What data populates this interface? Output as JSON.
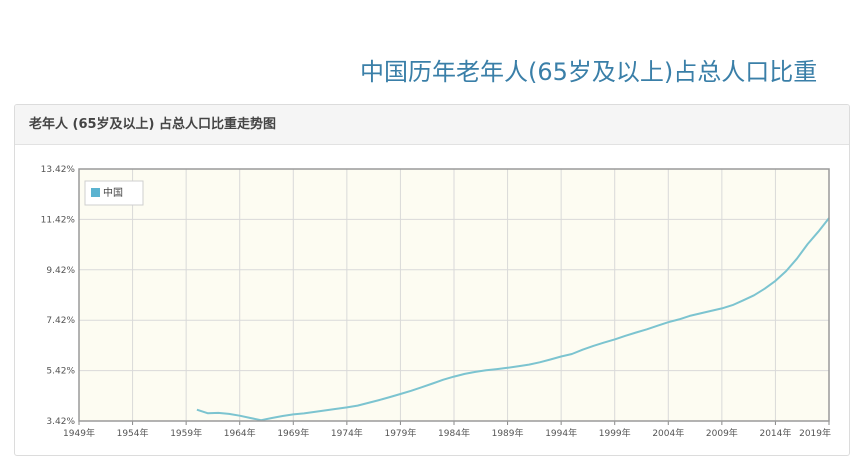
{
  "page": {
    "title": "中国历年老年人(65岁及以上)占总人口比重"
  },
  "panel": {
    "heading": "老年人 (65岁及以上) 占总人口比重走势图"
  },
  "colors": {
    "line": "#7cc4d0",
    "legend_swatch": "#5bb3d0",
    "plot_bg": "#fdfcf2",
    "grid": "#d9d9d9",
    "title": "#3a7fa8"
  },
  "chart_data": {
    "type": "line",
    "title": "老年人 (65岁及以上) 占总人口比重走势图",
    "xlabel": "",
    "ylabel": "",
    "xlim": [
      1949,
      2019
    ],
    "ylim": [
      3.42,
      13.42
    ],
    "grid": true,
    "legend_position": "top-left",
    "y_ticks": [
      {
        "value": 3.42,
        "label": "3.42%"
      },
      {
        "value": 5.42,
        "label": "5.42%"
      },
      {
        "value": 7.42,
        "label": "7.42%"
      },
      {
        "value": 9.42,
        "label": "9.42%"
      },
      {
        "value": 11.42,
        "label": "11.42%"
      },
      {
        "value": 13.42,
        "label": "13.42%"
      }
    ],
    "x_ticks": [
      {
        "value": 1949,
        "label": "1949年"
      },
      {
        "value": 1954,
        "label": "1954年"
      },
      {
        "value": 1959,
        "label": "1959年"
      },
      {
        "value": 1964,
        "label": "1964年"
      },
      {
        "value": 1969,
        "label": "1969年"
      },
      {
        "value": 1974,
        "label": "1974年"
      },
      {
        "value": 1979,
        "label": "1979年"
      },
      {
        "value": 1984,
        "label": "1984年"
      },
      {
        "value": 1989,
        "label": "1989年"
      },
      {
        "value": 1994,
        "label": "1994年"
      },
      {
        "value": 1999,
        "label": "1999年"
      },
      {
        "value": 2004,
        "label": "2004年"
      },
      {
        "value": 2009,
        "label": "2009年"
      },
      {
        "value": 2014,
        "label": "2014年"
      },
      {
        "value": 2019,
        "label": "2019年"
      }
    ],
    "series": [
      {
        "name": "中国",
        "x": [
          1960,
          1961,
          1962,
          1963,
          1964,
          1965,
          1966,
          1967,
          1968,
          1969,
          1970,
          1971,
          1972,
          1973,
          1974,
          1975,
          1976,
          1977,
          1978,
          1979,
          1980,
          1981,
          1982,
          1983,
          1984,
          1985,
          1986,
          1987,
          1988,
          1989,
          1990,
          1991,
          1992,
          1993,
          1994,
          1995,
          1996,
          1997,
          1998,
          1999,
          2000,
          2001,
          2002,
          2003,
          2004,
          2005,
          2006,
          2007,
          2008,
          2009,
          2010,
          2011,
          2012,
          2013,
          2014,
          2015,
          2016,
          2017,
          2018,
          2019
        ],
        "y": [
          3.87,
          3.73,
          3.74,
          3.7,
          3.63,
          3.54,
          3.45,
          3.54,
          3.62,
          3.68,
          3.72,
          3.78,
          3.84,
          3.9,
          3.96,
          4.03,
          4.14,
          4.25,
          4.37,
          4.49,
          4.62,
          4.76,
          4.91,
          5.06,
          5.18,
          5.29,
          5.37,
          5.43,
          5.48,
          5.53,
          5.59,
          5.66,
          5.75,
          5.86,
          5.98,
          6.08,
          6.25,
          6.4,
          6.53,
          6.66,
          6.8,
          6.93,
          7.06,
          7.2,
          7.34,
          7.45,
          7.59,
          7.69,
          7.79,
          7.89,
          8.02,
          8.21,
          8.41,
          8.67,
          8.98,
          9.37,
          9.86,
          10.44,
          10.93,
          11.47
        ]
      }
    ]
  }
}
